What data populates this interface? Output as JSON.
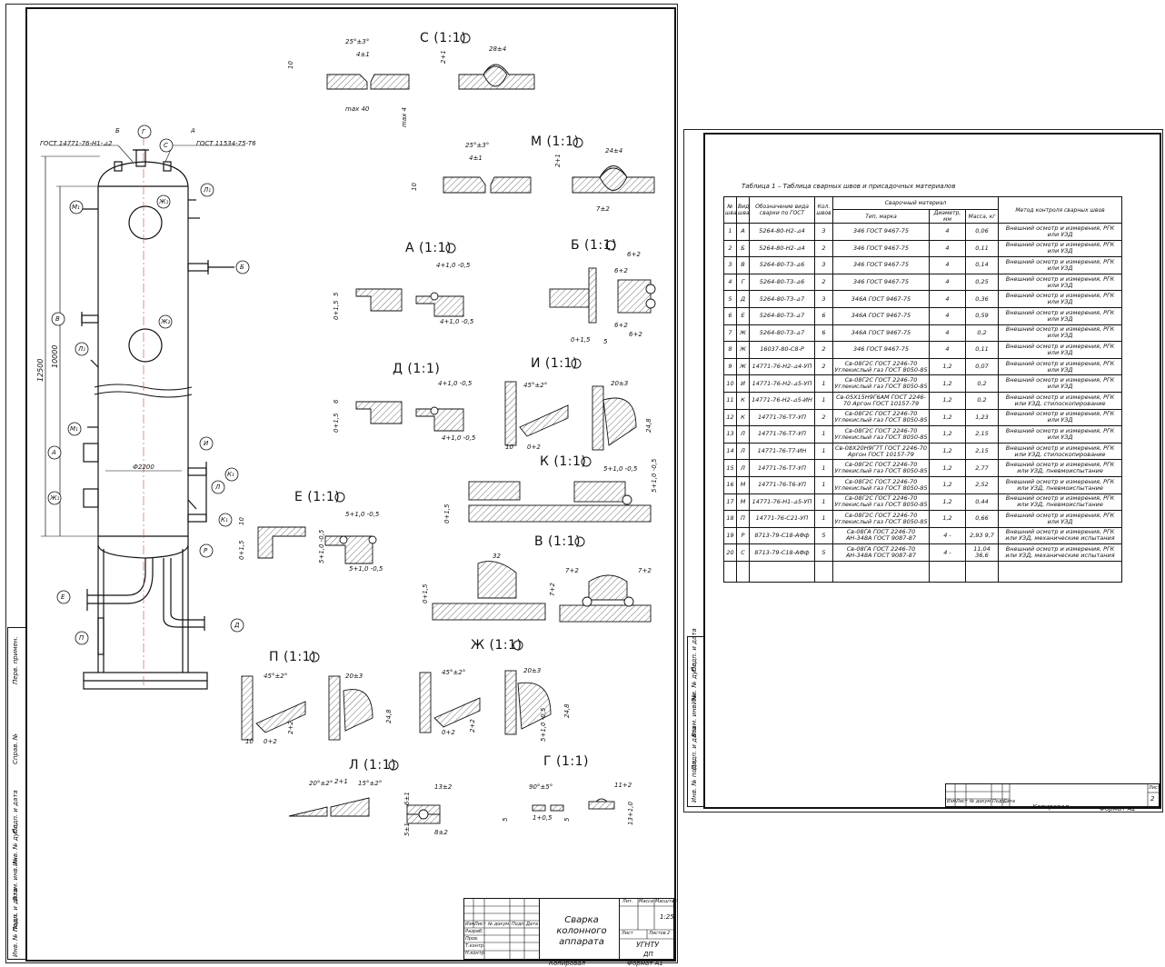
{
  "sheet1": {
    "title_block": {
      "name_line1": "Сварка колонного",
      "name_line2": "аппарата",
      "lit_label": "Лит.",
      "mass_label": "Масса",
      "scale_label": "Масштаб",
      "scale": "1:25",
      "sheet_label": "Лист",
      "sheets_label": "Листов",
      "sheets": "2",
      "org": "УГНТУ",
      "code": "ДП",
      "copied": "Копировал",
      "format": "Формат  A1",
      "cols": [
        "Изм.",
        "Лист",
        "№ докум.",
        "Подп.",
        "Дата"
      ],
      "roles": [
        "Разраб.",
        "Пров.",
        "Т.контр.",
        "Н.контр.",
        "Утв."
      ]
    },
    "left_strip": [
      "Перв. примен.",
      "Справ. №",
      "Подп. и дата",
      "Инв. № дубл.",
      "Взам. инв. №",
      "Подп. и дата",
      "Инв. № подл."
    ],
    "column": {
      "gost_left": "ГОСТ 14771-76-Н1-⊿2",
      "gost_right": "ГОСТ 11534-75-Т6",
      "dim_total": "12500",
      "dim_inner": "10000",
      "diameter": "Ф2200",
      "markers": [
        "Б",
        "Г",
        "С",
        "А",
        "М₁",
        "Л₁",
        "Ж₁",
        "Б",
        "В",
        "Л₁",
        "Ж₂",
        "М₁",
        "А",
        "И",
        "К₁",
        "Ж₁",
        "Л",
        "К₁",
        "Р",
        "Е",
        "П",
        "Д",
        "В",
        "Е"
      ]
    },
    "details": [
      {
        "label": "С (1:1)",
        "dims": [
          "25°±3°",
          "4±1",
          "28±4",
          "max 40",
          "max 4",
          "2+1",
          "10"
        ]
      },
      {
        "label": "М (1:1)",
        "dims": [
          "25°±3°",
          "4±1",
          "24±4",
          "7±2",
          "2+1",
          "10"
        ]
      },
      {
        "label": "А (1:1)",
        "dims": [
          "4+1,0 -0,5",
          "4+1,0 -0,5",
          "5",
          "0+1,5"
        ]
      },
      {
        "label": "Б (1:1)",
        "dims": [
          "6+2",
          "6+2",
          "6+2",
          "6+2",
          "5",
          "0+1,5"
        ]
      },
      {
        "label": "Д (1:1)",
        "dims": [
          "4+1,0 -0,5",
          "4+1,0 -0,5",
          "6",
          "0+1,5"
        ]
      },
      {
        "label": "И (1:1)",
        "dims": [
          "45°±2°",
          "20±3",
          "24,8",
          "10",
          "0+2"
        ]
      },
      {
        "label": "К (1:1)",
        "dims": [
          "5+1,0 -0,5",
          "5+1,0 -0,5",
          "0+1,5"
        ]
      },
      {
        "label": "Е (1:1)",
        "dims": [
          "5+1,0 -0,5",
          "5+1,0 -0,5",
          "5+1,0 -0,5",
          "10",
          "0+1,5"
        ]
      },
      {
        "label": "В (1:1)",
        "dims": [
          "32",
          "7+2",
          "7+2",
          "7+2",
          "0+1,5"
        ]
      },
      {
        "label": "П (1:1)",
        "dims": [
          "45°±2°",
          "20±3",
          "24,8",
          "10",
          "0+2",
          "2+2"
        ]
      },
      {
        "label": "Ж (1:1)",
        "dims": [
          "45°±2°",
          "20±3",
          "24,8",
          "0+2",
          "2+2",
          "5+1,0 -0,5"
        ]
      },
      {
        "label": "Л (1:1)",
        "dims": [
          "20°±2°",
          "2+1",
          "15°±2°",
          "13±2",
          "8±2",
          "6±1",
          "5±1"
        ]
      },
      {
        "label": "Г (1:1)",
        "dims": [
          "90°±5°",
          "11+2",
          "1+0,5",
          "5",
          "13+1,0",
          "5"
        ]
      }
    ]
  },
  "sheet2": {
    "table_title": "Таблица 1 – Таблица сварных швов и присадочных материалов",
    "headers": {
      "num": "№ шва",
      "kind": "Вид шва",
      "designation": "Обозначение вида сварки по ГОСТ",
      "count": "Кол. швов",
      "material_group": "Сварочный материал",
      "type": "Тип, марка",
      "diameter": "Диаметр, мм",
      "mass": "Масса, кг",
      "method": "Метод контроля сварных швов"
    },
    "rows": [
      [
        "1",
        "А",
        "5264-80-Н2-⊿4",
        "3",
        "346 ГОСТ 9467-75",
        "4",
        "0,06",
        "Внешний осмотр и измерения, РГК или УЗД"
      ],
      [
        "2",
        "Б",
        "5264-80-Н2-⊿4",
        "2",
        "346 ГОСТ 9467-75",
        "4",
        "0,11",
        "Внешний осмотр и измерения, РГК или УЗД"
      ],
      [
        "3",
        "В",
        "5264-80-Т3-⊿6",
        "3",
        "346 ГОСТ 9467-75",
        "4",
        "0,14",
        "Внешний осмотр и измерения, РГК или УЗД"
      ],
      [
        "4",
        "Г",
        "5264-80-Т3-⊿6",
        "2",
        "346 ГОСТ 9467-75",
        "4",
        "0,25",
        "Внешний осмотр и измерения, РГК или УЗД"
      ],
      [
        "5",
        "Д",
        "5264-80-Т3-⊿7",
        "3",
        "346А ГОСТ 9467-75",
        "4",
        "0,36",
        "Внешний осмотр и измерения, РГК или УЗД"
      ],
      [
        "6",
        "Е",
        "5264-80-Т3-⊿7",
        "6",
        "346А ГОСТ 9467-75",
        "4",
        "0,59",
        "Внешний осмотр и измерения, РГК или УЗД"
      ],
      [
        "7",
        "Ж",
        "5264-80-Т3-⊿7",
        "6",
        "346А ГОСТ 9467-75",
        "4",
        "0,2",
        "Внешний осмотр и измерения, РГК или УЗД"
      ],
      [
        "8",
        "Ж",
        "16037-80-С8-Р",
        "2",
        "346 ГОСТ 9467-75",
        "4",
        "0,11",
        "Внешний осмотр и измерения, РГК или УЗД"
      ],
      [
        "9",
        "Ж",
        "14771-76-Н2-⊿4-УП",
        "2",
        "Св-08Г2С ГОСТ 2246-70 Углекислый газ ГОСТ 8050-85",
        "1,2",
        "0,07",
        "Внешний осмотр и измерения, РГК или УЗД"
      ],
      [
        "10",
        "И",
        "14771-76-Н2-⊿5-УП",
        "1",
        "Св-08Г2С ГОСТ 2246-70 Углекислый газ ГОСТ 8050-85",
        "1,2",
        "0,2",
        "Внешний осмотр и измерения, РГК или УЗД"
      ],
      [
        "11",
        "К",
        "14771-76-Н2-⊿5-ИН",
        "1",
        "Св-05Х15Н9Г6АМ ГОСТ 2246-70 Аргон ГОСТ 10157-79",
        "1,2",
        "0,2",
        "Внешний осмотр и измерения, РГК или УЗД, стилоскопирование"
      ],
      [
        "12",
        "К",
        "14771-76-Т7-УП",
        "2",
        "Св-08Г2С ГОСТ 2246-70 Углекислый газ ГОСТ 8050-85",
        "1,2",
        "1,23",
        "Внешний осмотр и измерения, РГК или УЗД"
      ],
      [
        "13",
        "Л",
        "14771-76-Т7-УП",
        "1",
        "Св-08Г2С ГОСТ 2246-70 Углекислый газ ГОСТ 8050-85",
        "1,2",
        "2,15",
        "Внешний осмотр и измерения, РГК или УЗД"
      ],
      [
        "14",
        "Л",
        "14771-76-Т7-ИН",
        "1",
        "Св-08Х20Н9Г7Т ГОСТ 2246-70 Аргон ГОСТ 10157-79",
        "1,2",
        "2,15",
        "Внешний осмотр и измерения, РГК или УЗД, стилоскопирование"
      ],
      [
        "15",
        "Л",
        "14771-76-Т7-УП",
        "1",
        "Св-08Г2С ГОСТ 2246-70 Углекислый газ ГОСТ 8050-85",
        "1,2",
        "2,77",
        "Внешний осмотр и измерения, РГК или УЗД, пневмоиспытание"
      ],
      [
        "16",
        "М",
        "14771-76-Т6-УП",
        "1",
        "Св-08Г2С ГОСТ 2246-70 Углекислый газ ГОСТ 8050-85",
        "1,2",
        "2,52",
        "Внешний осмотр и измерения, РГК или УЗД, пневмоиспытание"
      ],
      [
        "17",
        "М",
        "14771-76-Н1-⊿5-УП",
        "1",
        "Св-08Г2С ГОСТ 2246-70 Углекислый газ ГОСТ 8050-85",
        "1,2",
        "0,44",
        "Внешний осмотр и измерения, РГК или УЗД, пневмоиспытание"
      ],
      [
        "18",
        "П",
        "14771-76-С21-УП",
        "1",
        "Св-08Г2С ГОСТ 2246-70 Углекислый газ ГОСТ 8050-85",
        "1,2",
        "0,66",
        "Внешний осмотр и измерения, РГК или УЗД"
      ],
      [
        "19",
        "Р",
        "8713-79-С18-АФф",
        "5",
        "Св-08ГА ГОСТ 2246-70 АН-348А ГОСТ 9087-87",
        "4 -",
        "2,93 9,7",
        "Внешний осмотр и измерения, РГК или УЗД, механические испытания"
      ],
      [
        "20",
        "С",
        "8713-79-С18-АФф",
        "5",
        "Св-08ГА ГОСТ 2246-70 АН-348А ГОСТ 9087-87",
        "4 -",
        "11,04 36,6",
        "Внешний осмотр и измерения, РГК или УЗД, механические испытания"
      ]
    ],
    "footer": {
      "cols": [
        "Изм.",
        "Лист",
        "№ докум.",
        "Подп.",
        "Дата"
      ],
      "sheet_label": "Лист",
      "sheet_num": "2",
      "copied": "Копировал",
      "format": "Формат  А2"
    },
    "left_strip": [
      "Инв. № подл.",
      "Подп. и дата",
      "Взам. инв. №",
      "Инв. № дубл.",
      "Подп. и дата"
    ]
  }
}
